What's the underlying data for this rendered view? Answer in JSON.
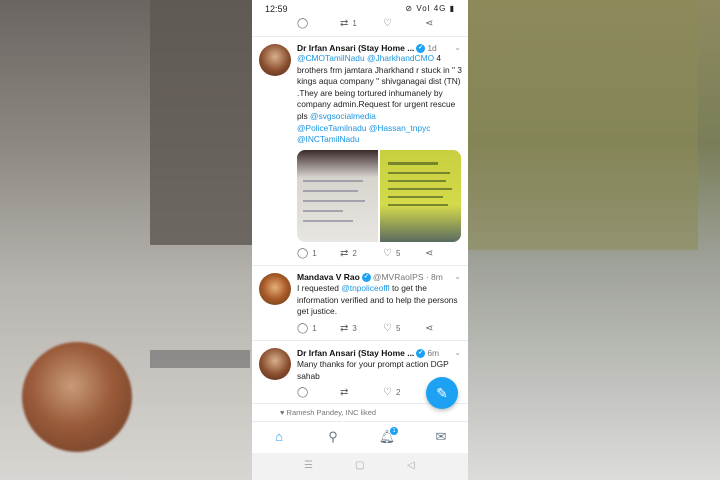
{
  "status_bar": {
    "time": "12:59",
    "icons": "⊘ Vol 4G ▮"
  },
  "top_actions": [
    {
      "icon": "reply-icon",
      "count": ""
    },
    {
      "icon": "retweet-icon",
      "count": "1"
    },
    {
      "icon": "like-icon",
      "count": ""
    },
    {
      "icon": "share-icon",
      "count": ""
    }
  ],
  "tweets": [
    {
      "name": "Dr Irfan Ansari (Stay Home ...",
      "meta": "1d",
      "text_parts": [
        "@CMOTamilNadu",
        " ",
        "@JharkhandCMO",
        " 4 brothers frm jamtara Jharkhand r stuck in \" 3 kings aqua company \" shivganagai dist (TN) .They are being tortured inhumanely  by company admin.Request for urgent rescue pls ",
        "@svgsocialmedia",
        " ",
        "@PoliceTamilnadu",
        " ",
        "@Hassan_tnpyc",
        " ",
        "@INCTamilNadu"
      ],
      "media": [
        {
          "label": "handwritten-note-photo"
        },
        {
          "label": "visiting-card-photo"
        }
      ],
      "counts": {
        "reply": "1",
        "retweet": "2",
        "like": "5"
      }
    },
    {
      "name": "Mandava V Rao",
      "meta": "@MVRaoIPS · 8m",
      "text_parts": [
        "I requested ",
        "@tnpoliceoffl",
        " to get the information verified and to help the persons get justice."
      ],
      "counts": {
        "reply": "1",
        "retweet": "3",
        "like": "5"
      }
    },
    {
      "name": "Dr Irfan Ansari (Stay Home ...",
      "meta": "6m",
      "text_parts": [
        "Many thanks for your prompt action DGP sahab"
      ],
      "counts": {
        "reply": "",
        "retweet": "",
        "like": "2"
      }
    }
  ],
  "liked_notice": "Ramesh Pandey, INC liked",
  "tab_bar": {
    "notifications_badge": "1"
  },
  "colors": {
    "accent": "#1da1f2",
    "mention": "#1b95e0"
  }
}
